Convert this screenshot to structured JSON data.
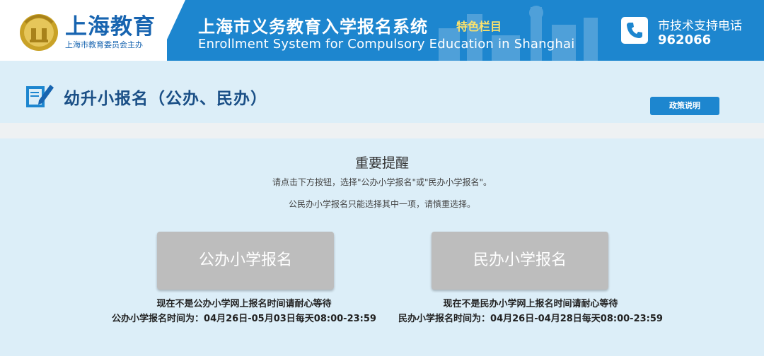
{
  "header": {
    "brand_name": "上海教育",
    "brand_sub": "上海市教育委员会主办",
    "system_title": "上海市义务教育入学报名系统",
    "system_tag": "特色栏目",
    "system_title_en": "Enrollment System for Compulsory Education in Shanghai",
    "support_label": "市技术支持电话",
    "support_number": "962066"
  },
  "page": {
    "title": "幼升小报名（公办、民办）",
    "policy_button": "政策说明"
  },
  "notice": {
    "title": "重要提醒",
    "line1": "请点击下方按钮，选择\"公办小学报名\"或\"民办小学报名\"。",
    "line2": "公民办小学报名只能选择其中一项，请慎重选择。"
  },
  "registration": {
    "public": {
      "button_label": "公办小学报名",
      "status": "现在不是公办小学网上报名时间请耐心等待",
      "time": "公办小学报名时间为：04月26日-05月03日每天08:00-23:59"
    },
    "private": {
      "button_label": "民办小学报名",
      "status": "现在不是民办小学网上报名时间请耐心等待",
      "time": "民办小学报名时间为：04月26日-04月28日每天08:00-23:59"
    }
  },
  "colors": {
    "header_blue": "#1d86cf",
    "brand_blue": "#1764b0",
    "tag_yellow": "#ffe36a",
    "button_gray": "#bdbdbd",
    "band_light_blue": "#dceef8"
  },
  "icons": {
    "emblem": "shanghai-education-emblem-icon",
    "phone": "phone-icon",
    "pencil": "pencil-notebook-icon"
  }
}
